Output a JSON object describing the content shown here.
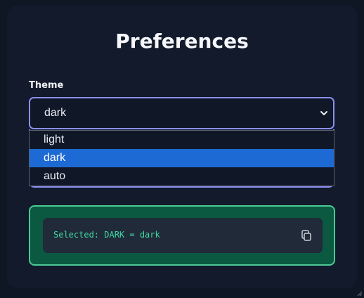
{
  "title": "Preferences",
  "theme": {
    "label": "Theme",
    "selected": "dark",
    "options": [
      "light",
      "dark",
      "auto"
    ],
    "selected_index": 1
  },
  "result": {
    "text": "Selected: DARK = dark"
  },
  "icons": {
    "select_chevron": "chevron-down-icon",
    "copy": "copy-icon",
    "resize": "resize-grip-icon"
  },
  "colors": {
    "accent_border": "#8b8ff0",
    "option_highlight": "#1e6ad4",
    "success_bg": "#0a5940",
    "success_border": "#4cc995",
    "code_text": "#3fd9a2"
  }
}
